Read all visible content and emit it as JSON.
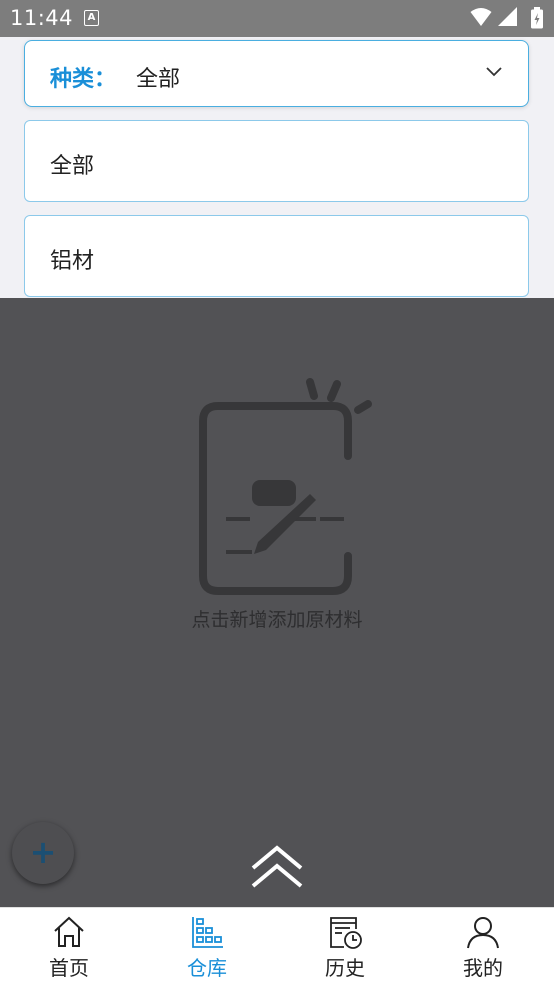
{
  "status_bar": {
    "time": "11:44",
    "notification_icon": "A"
  },
  "filter": {
    "label": "种类：",
    "selected_value": "全部",
    "options": [
      "全部",
      "铝材"
    ]
  },
  "empty_state": {
    "icon": "clipboard-pen-icon",
    "message": "点击新增添加原材料"
  },
  "fab": {
    "label": "+"
  },
  "bottom_nav": {
    "items": [
      {
        "label": "首页",
        "icon": "home-icon",
        "active": false
      },
      {
        "label": "仓库",
        "icon": "warehouse-icon",
        "active": true
      },
      {
        "label": "历史",
        "icon": "history-icon",
        "active": false
      },
      {
        "label": "我的",
        "icon": "profile-icon",
        "active": false
      }
    ]
  },
  "colors": {
    "accent": "#1a8fd8",
    "overlay": "#525255",
    "status_bar": "#7d7d7d"
  }
}
